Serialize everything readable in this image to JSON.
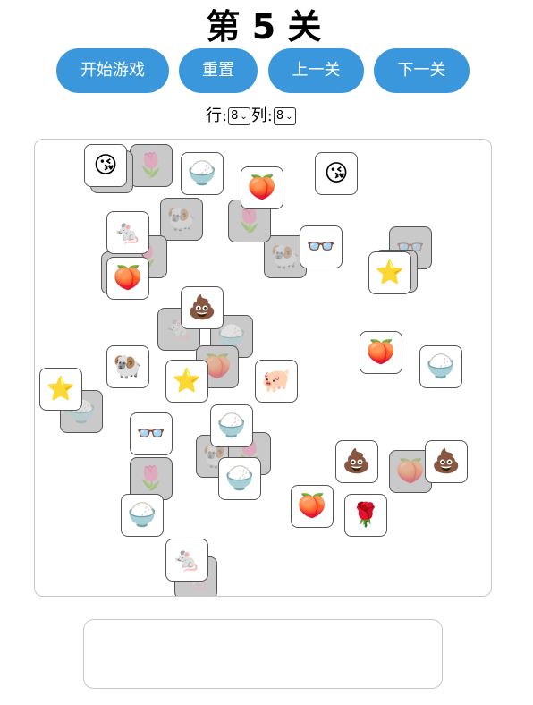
{
  "title": "第 5 关",
  "buttons": {
    "start": "开始游戏",
    "reset": "重置",
    "prev": "上一关",
    "next": "下一关"
  },
  "controls": {
    "rows_label": "行:",
    "rows_value": "8",
    "cols_label": "列:",
    "cols_value": "8"
  },
  "colors": {
    "button": "#3b97dc",
    "blocked_tile": "#c9c9c9"
  },
  "tiles": [
    {
      "icon": "🐏",
      "blocked": true
    },
    {
      "icon": "🌷",
      "blocked": true
    },
    {
      "icon": "🌷",
      "blocked": true
    },
    {
      "icon": "🐏",
      "blocked": true
    },
    {
      "icon": "🌷",
      "blocked": true
    },
    {
      "icon": "👓",
      "blocked": true
    },
    {
      "icon": "🍑",
      "blocked": true
    },
    {
      "icon": "🐁",
      "blocked": true
    },
    {
      "icon": "🍚",
      "blocked": true
    },
    {
      "icon": "🍑",
      "blocked": true
    },
    {
      "icon": "🍚",
      "blocked": true
    },
    {
      "icon": "🐏",
      "blocked": true
    },
    {
      "icon": "🌷",
      "blocked": true
    },
    {
      "icon": "🌷",
      "blocked": true
    },
    {
      "icon": "🍑",
      "blocked": true
    },
    {
      "icon": "🐁",
      "blocked": true
    },
    {
      "icon": "😘",
      "blocked": true
    },
    {
      "icon": "⭐",
      "blocked": true
    },
    {
      "icon": "😘",
      "blocked": false
    },
    {
      "icon": "🍚",
      "blocked": false
    },
    {
      "icon": "🍑",
      "blocked": false
    },
    {
      "icon": "😘",
      "blocked": false
    },
    {
      "icon": "🐁",
      "blocked": false
    },
    {
      "icon": "👓",
      "blocked": false
    },
    {
      "icon": "⭐",
      "blocked": false
    },
    {
      "icon": "🍑",
      "blocked": false
    },
    {
      "icon": "💩",
      "blocked": false
    },
    {
      "icon": "🍑",
      "blocked": false
    },
    {
      "icon": "🍚",
      "blocked": false
    },
    {
      "icon": "🐏",
      "blocked": false
    },
    {
      "icon": "⭐",
      "blocked": false
    },
    {
      "icon": "🐖",
      "blocked": false
    },
    {
      "icon": "⭐",
      "blocked": false
    },
    {
      "icon": "👓",
      "blocked": false
    },
    {
      "icon": "🍚",
      "blocked": false
    },
    {
      "icon": "🍚",
      "blocked": false
    },
    {
      "icon": "💩",
      "blocked": false
    },
    {
      "icon": "💩",
      "blocked": false
    },
    {
      "icon": "🍑",
      "blocked": false
    },
    {
      "icon": "🌹",
      "blocked": false
    },
    {
      "icon": "🍚",
      "blocked": false
    },
    {
      "icon": "🐁",
      "blocked": false
    }
  ],
  "tray": {
    "items": []
  }
}
